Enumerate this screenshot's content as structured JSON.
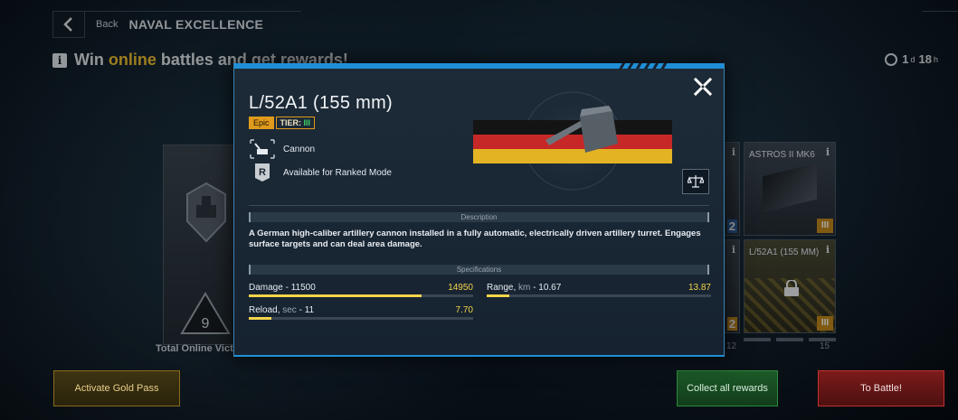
{
  "header": {
    "back_label": "Back",
    "title": "NAVAL EXCELLENCE"
  },
  "promo": {
    "prefix": "Win",
    "highlight": "online",
    "suffix": "battles and get rewards!"
  },
  "timer": {
    "days": "1",
    "days_unit": "d",
    "hours": "18",
    "hours_unit": "h"
  },
  "left_card": {
    "value": "9",
    "label": "Total Online Vict"
  },
  "reward_cards": [
    {
      "name": "ASTROS II MK6",
      "tier": "III",
      "locked": false
    },
    {
      "name": "L/52A1 (155 MM)",
      "tier": "III",
      "locked": true
    }
  ],
  "partial_cards": [
    {
      "number": "2"
    },
    {
      "number": "2"
    }
  ],
  "progress_numbers": {
    "left": "12",
    "right": "15"
  },
  "buttons": {
    "gold_pass": "Activate Gold Pass",
    "collect": "Collect all rewards",
    "battle": "To Battle!"
  },
  "modal": {
    "weapon_name": "L/52A1 (155 mm)",
    "rarity": "Epic",
    "tier_label": "TIER:",
    "tier_value": "III",
    "properties": [
      {
        "icon": "cannon-icon",
        "text": "Cannon"
      },
      {
        "icon": "ranked-mode-icon",
        "text": "Available for Ranked Mode"
      }
    ],
    "description_header": "Description",
    "description": "A German high-caliber artillery cannon installed in a fully automatic, electrically driven artillery turret. Engages surface targets and can deal area damage.",
    "specs_header": "Specifications",
    "specs": [
      {
        "label": "Damage",
        "unit": "",
        "value": "11500",
        "max": "14950",
        "fraction": 0.77
      },
      {
        "label": "Range,",
        "unit": "km",
        "value": "10.67",
        "max": "13.87",
        "fraction": 0.1
      },
      {
        "label": "Reload,",
        "unit": "sec",
        "value": "11",
        "max": "7.70",
        "fraction": 0.1
      }
    ]
  },
  "colors": {
    "accent_blue": "#1f8fd6",
    "epic": "#e09a1c",
    "tier_green": "#3fd46a",
    "spec_yellow": "#f3d44a"
  }
}
